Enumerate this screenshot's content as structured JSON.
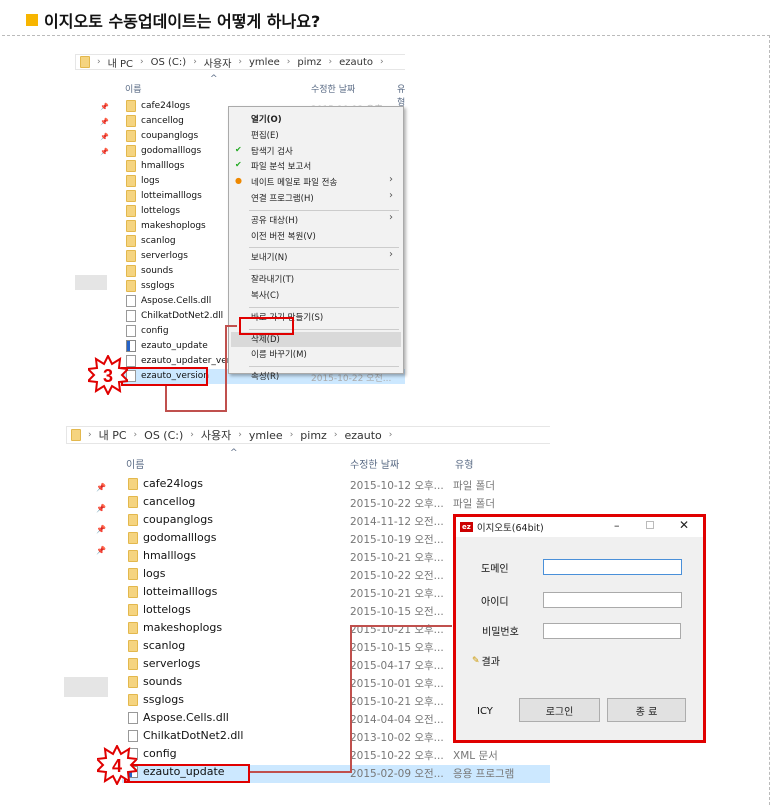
{
  "title": "이지오토 수동업데이트는 어떻게 하나요?",
  "breadcrumb": [
    "내 PC",
    "OS (C:)",
    "사용자",
    "ymlee",
    "pimz",
    "ezauto"
  ],
  "columns": {
    "name": "이름",
    "date": "수정한 날짜",
    "type": "유형"
  },
  "explorer1": {
    "files": [
      {
        "name": "cafe24logs",
        "icon": "folder"
      },
      {
        "name": "cancellog",
        "icon": "folder"
      },
      {
        "name": "coupanglogs",
        "icon": "folder"
      },
      {
        "name": "godomalllogs",
        "icon": "folder"
      },
      {
        "name": "hmalllogs",
        "icon": "folder"
      },
      {
        "name": "logs",
        "icon": "folder"
      },
      {
        "name": "lotteimalllogs",
        "icon": "folder"
      },
      {
        "name": "lottelogs",
        "icon": "folder"
      },
      {
        "name": "makeshoplogs",
        "icon": "folder"
      },
      {
        "name": "scanlog",
        "icon": "folder"
      },
      {
        "name": "serverlogs",
        "icon": "folder"
      },
      {
        "name": "sounds",
        "icon": "folder"
      },
      {
        "name": "ssglogs",
        "icon": "folder"
      },
      {
        "name": "Aspose.Cells.dll",
        "icon": "file"
      },
      {
        "name": "ChilkatDotNet2.dll",
        "icon": "file"
      },
      {
        "name": "config",
        "icon": "file"
      },
      {
        "name": "ezauto_update",
        "icon": "exe"
      },
      {
        "name": "ezauto_updater_version",
        "icon": "file"
      },
      {
        "name": "ezauto_version",
        "icon": "file"
      }
    ],
    "first_date": "2015-10-12 오후",
    "selected_date": "2015-10-22 오전...",
    "context_menu": [
      {
        "label": "열기(O)",
        "bold": true
      },
      {
        "label": "편집(E)"
      },
      {
        "label": "탐색기 검사",
        "icon": "v3-icon"
      },
      {
        "label": "파일 분석 보고서",
        "icon": "v3-icon"
      },
      {
        "label": "네이트 메일로 파일 전송",
        "icon": "nate-icon",
        "submenu": true
      },
      {
        "label": "연결 프로그램(H)",
        "submenu": true
      },
      {
        "sep": true
      },
      {
        "label": "공유 대상(H)",
        "submenu": true
      },
      {
        "label": "이전 버전 복원(V)"
      },
      {
        "sep": true
      },
      {
        "label": "보내기(N)",
        "submenu": true
      },
      {
        "sep": true
      },
      {
        "label": "잘라내기(T)"
      },
      {
        "label": "복사(C)"
      },
      {
        "sep": true
      },
      {
        "label": "바로 가기 만들기(S)"
      },
      {
        "sep": true
      },
      {
        "label": "삭제(D)",
        "highlight": true
      },
      {
        "label": "이름 바꾸기(M)"
      },
      {
        "sep": true
      },
      {
        "label": "속성(R)"
      }
    ],
    "step": "3"
  },
  "explorer2": {
    "files": [
      {
        "name": "cafe24logs",
        "icon": "folder",
        "date": "2015-10-12 오후...",
        "type": "파일 폴더"
      },
      {
        "name": "cancellog",
        "icon": "folder",
        "date": "2015-10-22 오후...",
        "type": "파일 폴더"
      },
      {
        "name": "coupanglogs",
        "icon": "folder",
        "date": "2014-11-12 오전..."
      },
      {
        "name": "godomalllogs",
        "icon": "folder",
        "date": "2015-10-19 오전..."
      },
      {
        "name": "hmalllogs",
        "icon": "folder",
        "date": "2015-10-21 오후..."
      },
      {
        "name": "logs",
        "icon": "folder",
        "date": "2015-10-22 오전..."
      },
      {
        "name": "lotteimalllogs",
        "icon": "folder",
        "date": "2015-10-21 오후..."
      },
      {
        "name": "lottelogs",
        "icon": "folder",
        "date": "2015-10-15 오전..."
      },
      {
        "name": "makeshoplogs",
        "icon": "folder",
        "date": "2015-10-21 오후..."
      },
      {
        "name": "scanlog",
        "icon": "folder",
        "date": "2015-10-15 오후..."
      },
      {
        "name": "serverlogs",
        "icon": "folder",
        "date": "2015-04-17 오후..."
      },
      {
        "name": "sounds",
        "icon": "folder",
        "date": "2015-10-01 오후..."
      },
      {
        "name": "ssglogs",
        "icon": "folder",
        "date": "2015-10-21 오후..."
      },
      {
        "name": "Aspose.Cells.dll",
        "icon": "file",
        "date": "2014-04-04 오전..."
      },
      {
        "name": "ChilkatDotNet2.dll",
        "icon": "file",
        "date": "2013-10-02 오후..."
      },
      {
        "name": "config",
        "icon": "file",
        "date": "2015-10-22 오후...",
        "type": "XML 문서"
      },
      {
        "name": "ezauto_update",
        "icon": "exe",
        "date": "2015-02-09 오전...",
        "type": "응용 프로그램"
      }
    ],
    "step": "4"
  },
  "dialog": {
    "title": "이지오토(64bit)",
    "app_icon": "ez",
    "domain_label": "도메인",
    "domain_value": "",
    "id_label": "아이디",
    "id_value": "",
    "password_label": "비밀번호",
    "password_value": "",
    "result_label": "결과",
    "icy_label": "ICY",
    "login_button": "로그인",
    "exit_button": "종  료"
  },
  "colors": {
    "highlight": "#e00000",
    "arrow": "#c0504d",
    "selection": "#cce8ff",
    "title_square": "#f7b500"
  }
}
